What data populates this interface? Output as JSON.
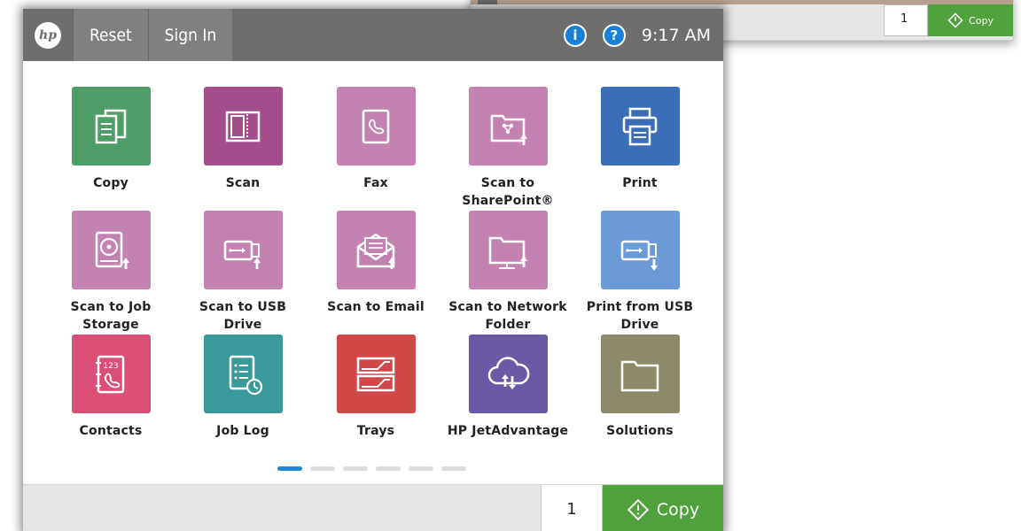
{
  "background_panel": {
    "quantity": "1",
    "copy_label": "Copy"
  },
  "topbar": {
    "logo_text": "hp",
    "reset_label": "Reset",
    "signin_label": "Sign In",
    "info_glyph": "i",
    "help_glyph": "?",
    "time": "9:17 AM",
    "colors": {
      "bar": "#6e6e6e",
      "status_icon": "#1a7fd6"
    }
  },
  "apps": [
    {
      "label": "Copy",
      "icon": "copy-icon",
      "color": "#4f9e6a"
    },
    {
      "label": "Scan",
      "icon": "scan-icon",
      "color": "#a44f8c"
    },
    {
      "label": "Fax",
      "icon": "fax-icon",
      "color": "#c482b0"
    },
    {
      "label": "Scan to SharePoint®",
      "icon": "sharepoint-icon",
      "color": "#c482b0"
    },
    {
      "label": "Print",
      "icon": "print-icon",
      "color": "#3a6fb8"
    },
    {
      "label": "Scan to Job Storage",
      "icon": "job-storage-icon",
      "color": "#c482b0"
    },
    {
      "label": "Scan to USB Drive",
      "icon": "usb-scan-icon",
      "color": "#c482b0"
    },
    {
      "label": "Scan to Email",
      "icon": "email-icon",
      "color": "#c482b0"
    },
    {
      "label": "Scan to Network Folder",
      "icon": "network-folder-icon",
      "color": "#c482b0"
    },
    {
      "label": "Print from USB Drive",
      "icon": "usb-print-icon",
      "color": "#6b9bd6"
    },
    {
      "label": "Contacts",
      "icon": "contacts-icon",
      "color": "#d94f76"
    },
    {
      "label": "Job Log",
      "icon": "job-log-icon",
      "color": "#3a9a9a"
    },
    {
      "label": "Trays",
      "icon": "trays-icon",
      "color": "#d04848"
    },
    {
      "label": "HP JetAdvantage",
      "icon": "cloud-icon",
      "color": "#6a5aa6"
    },
    {
      "label": "Solutions",
      "icon": "folder-icon",
      "color": "#8c8a6a"
    }
  ],
  "pagination": {
    "pages": 6,
    "current": 1
  },
  "bottombar": {
    "quantity": "1",
    "copy_label": "Copy",
    "copy_color": "#4fa23c"
  }
}
